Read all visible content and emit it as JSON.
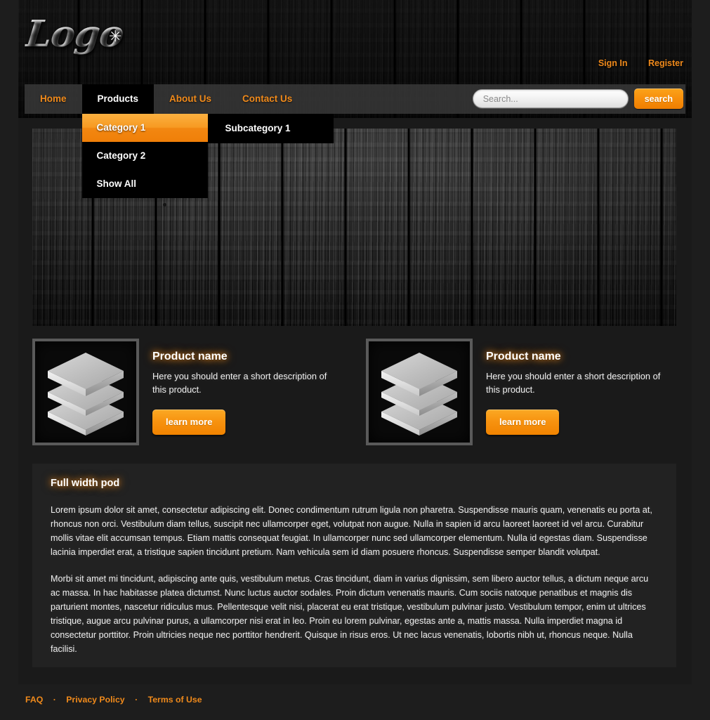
{
  "brand": {
    "logo_text": "Logo",
    "logo_star": "✳"
  },
  "accent_colors": {
    "orange": "#f08a1b",
    "orange_button": "#f18300",
    "nav_active_bg": "#000000",
    "page_bg": "#1d1d1d",
    "content_bg": "#1a1a1a",
    "pod_bg": "#222222"
  },
  "account": {
    "sign_in": "Sign In",
    "register": "Register"
  },
  "nav": {
    "items": [
      {
        "label": "Home",
        "active": false
      },
      {
        "label": "Products",
        "active": true
      },
      {
        "label": "About Us",
        "active": false
      },
      {
        "label": "Contact Us",
        "active": false
      }
    ],
    "dropdown": [
      {
        "label": "Category 1",
        "hover": true
      },
      {
        "label": "Category 2",
        "hover": false
      },
      {
        "label": "Show All",
        "hover": false
      }
    ],
    "submenu": [
      {
        "label": "Subcategory 1"
      }
    ]
  },
  "search": {
    "placeholder": "Search...",
    "value": "",
    "button_label": "search"
  },
  "products": [
    {
      "title": "Product name",
      "description": "Here you should enter a short description of this product.",
      "button_label": "learn more",
      "icon": "stacked-layers-icon"
    },
    {
      "title": "Product name",
      "description": "Here you should enter a short description of this product.",
      "button_label": "learn more",
      "icon": "stacked-layers-icon"
    }
  ],
  "full_pod": {
    "title": "Full width pod",
    "paragraphs": [
      "Lorem ipsum dolor sit amet, consectetur adipiscing elit. Donec condimentum rutrum ligula non pharetra. Suspendisse mauris quam, venenatis eu porta at, rhoncus non orci. Vestibulum diam tellus, suscipit nec ullamcorper eget, volutpat non augue. Nulla in sapien id arcu laoreet laoreet id vel arcu. Curabitur mollis vitae elit accumsan tempus. Etiam mattis consequat feugiat. In ullamcorper nunc sed ullamcorper elementum. Nulla id egestas diam. Suspendisse lacinia imperdiet erat, a tristique sapien tincidunt pretium. Nam vehicula sem id diam posuere rhoncus. Suspendisse semper blandit volutpat.",
      "Morbi sit amet mi tincidunt, adipiscing ante quis, vestibulum metus. Cras tincidunt, diam in varius dignissim, sem libero auctor tellus, a dictum neque arcu ac massa. In hac habitasse platea dictumst. Nunc luctus auctor sodales. Proin dictum venenatis mauris. Cum sociis natoque penatibus et magnis dis parturient montes, nascetur ridiculus mus. Pellentesque velit nisi, placerat eu erat tristique, vestibulum pulvinar justo. Vestibulum tempor, enim ut ultrices tristique, augue arcu pulvinar purus, a ullamcorper nisi erat in leo. Proin eu lorem pulvinar, egestas ante a, mattis massa. Nulla imperdiet magna id consectetur porttitor. Proin ultricies neque nec porttitor hendrerit. Quisque in risus eros. Ut nec lacus venenatis, lobortis nibh ut, rhoncus neque. Nulla facilisi."
    ]
  },
  "footer": {
    "links": [
      {
        "label": "FAQ"
      },
      {
        "label": "Privacy Policy"
      },
      {
        "label": "Terms of Use"
      }
    ],
    "separator": "·"
  }
}
